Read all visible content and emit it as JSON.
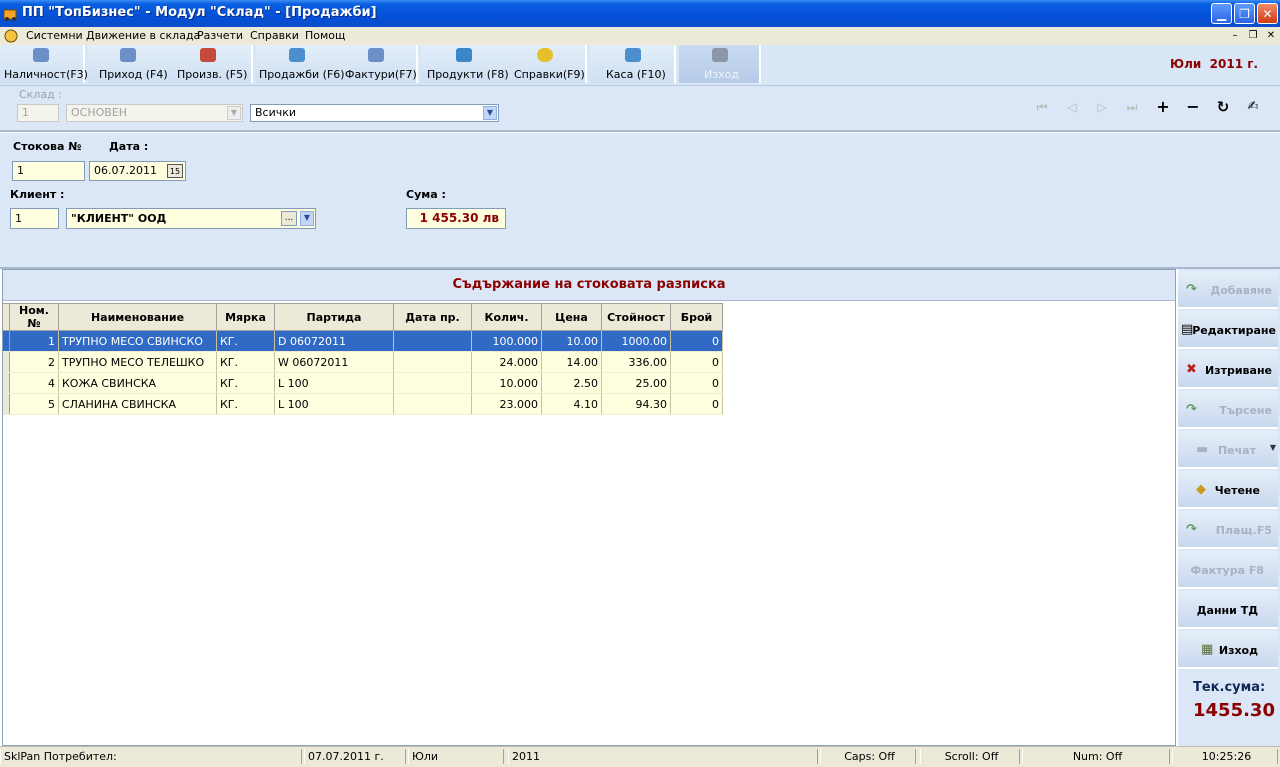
{
  "window": {
    "title": "ПП \"ТопБизнес\" - Модул \"Склад\" - [Продажби]"
  },
  "menu": [
    "Системни",
    "Движение в склада",
    "Разчети",
    "Справки",
    "Помощ"
  ],
  "toolbar": [
    "Наличност(F3)",
    "Приход (F4)",
    "Произв. (F5)",
    "Продажби (F6)",
    "Фактури(F7)",
    "Продукти (F8)",
    "Справки(F9)",
    "Каса (F10)",
    "Изход"
  ],
  "period": {
    "month": "Юли",
    "year": "2011 г."
  },
  "warehouse": {
    "label": "Склад :",
    "code": "1",
    "name": "ОСНОВЕН",
    "filter": "Всички"
  },
  "header": {
    "doc_no_label": "Стокова №",
    "doc_no": "1",
    "date_label": "Дата :",
    "date": "06.07.2011",
    "calendar_btn": "15",
    "client_label": "Клиент :",
    "client_code": "1",
    "client_name": "\"КЛИЕНТ\" ООД",
    "lookup_btn": "...",
    "sum_label": "Сума :",
    "sum": "1 455.30 лв"
  },
  "caption": "Съдържание на стоковата разписка",
  "grid": {
    "columns": [
      "Ном.№",
      "Наименование",
      "Мярка",
      "Партида",
      "Дата пр.",
      "Колич.",
      "Цена",
      "Стойност",
      "Брой"
    ],
    "rows": [
      [
        "1",
        "ТРУПНО МЕСО СВИНСКО",
        "КГ.",
        "D 06072011",
        "",
        "100.000",
        "10.00",
        "1000.00",
        "0"
      ],
      [
        "2",
        "ТРУПНО МЕСО ТЕЛЕШКО",
        "КГ.",
        "W 06072011",
        "",
        "24.000",
        "14.00",
        "336.00",
        "0"
      ],
      [
        "4",
        "КОЖА СВИНСКА",
        "КГ.",
        "L 100",
        "",
        "10.000",
        "2.50",
        "25.00",
        "0"
      ],
      [
        "5",
        "СЛАНИНА  СВИНСКА",
        "КГ.",
        "L 100",
        "",
        "23.000",
        "4.10",
        "94.30",
        "0"
      ]
    ],
    "selected_row": 0
  },
  "side": {
    "add": "Добавяне",
    "edit": "Редактиране",
    "delete": "Изтриване",
    "search": "Търсене",
    "print": "Печат",
    "read": "Четене",
    "pay": "Плащ.F5",
    "invoice": "Фактура F8",
    "td": "Данни ТД",
    "exit": "Изход",
    "cursum_label": "Тек.сума:",
    "cursum": "1455.30"
  },
  "statusbar": {
    "user": "SklPan Потребител:",
    "date": "07.07.2011 г.",
    "month": "Юли",
    "year": "2011",
    "caps": "Caps: Off",
    "scroll": "Scroll: Off",
    "num": "Num: Off",
    "time": "10:25:26"
  },
  "colors": {
    "titlebar": "#0450d8",
    "selection": "#316ac5",
    "accent_red": "#8b0000",
    "panel": "#dbe7f6",
    "grid_row": "#ffffe0"
  }
}
